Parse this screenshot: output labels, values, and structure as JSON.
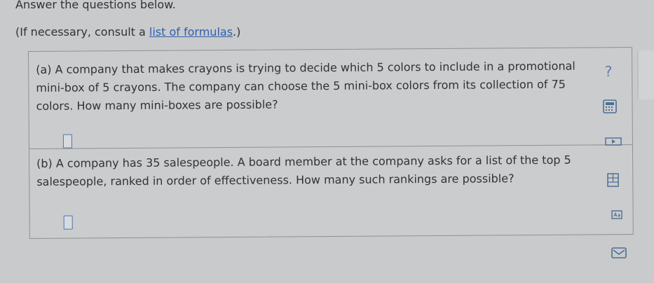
{
  "header": {
    "instruction": "Answer the questions below.",
    "consult_prefix": "(If necessary, consult a ",
    "formula_link": "list of formulas",
    "consult_suffix": ".)"
  },
  "questions": [
    {
      "text": "(a) A company that makes crayons is trying to decide which 5 colors to include in a promotional mini-box of 5 crayons. The company can choose the 5 mini-box colors from its collection of 75 colors. How many mini-boxes are possible?",
      "answer": ""
    },
    {
      "text": "(b) A company has 35 salespeople. A board member at the company asks for a list of the top 5 salespeople, ranked in order of effectiveness. How many such rankings are possible?",
      "answer": ""
    }
  ],
  "toolbar": {
    "help_symbol": "?",
    "icons": [
      "help-icon",
      "calculator-icon",
      "video-icon",
      "data-table-icon",
      "periodic-table-icon",
      "mail-icon"
    ]
  },
  "colors": {
    "link": "#2f5fae",
    "answer_border": "#4a76b8",
    "background": "#c9cacb"
  }
}
